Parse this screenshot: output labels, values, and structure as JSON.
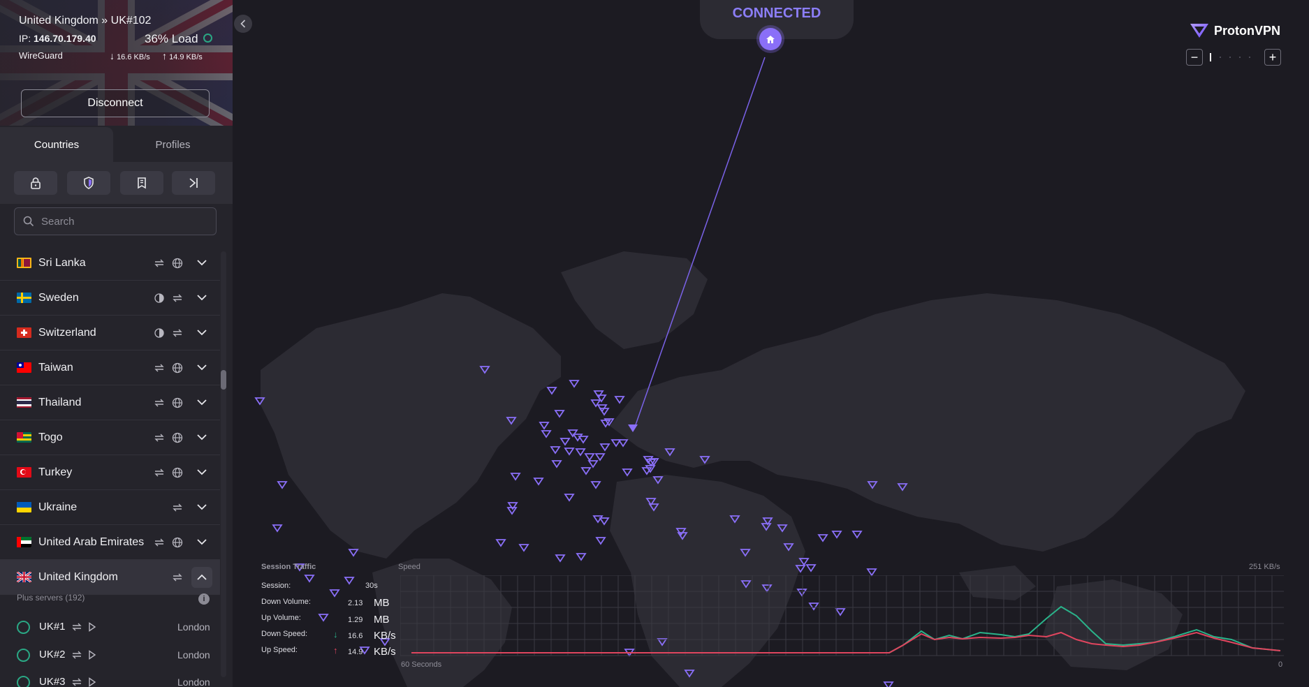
{
  "header": {
    "server_title": "United Kingdom » UK#102",
    "ip_label": "IP:",
    "ip_value": "146.70.179.40",
    "load": "36% Load",
    "protocol": "WireGuard",
    "down_rate": "16.6 KB/s",
    "up_rate": "14.9 KB/s",
    "disconnect_label": "Disconnect"
  },
  "tabs": {
    "countries": "Countries",
    "profiles": "Profiles"
  },
  "filters": {
    "icons": [
      "lock-icon",
      "shield-icon",
      "bill-icon",
      "skip-icon"
    ]
  },
  "search": {
    "placeholder": "Search"
  },
  "countries": [
    {
      "name": "Sri Lanka",
      "features": [
        "p2p-icon",
        "tor-globe-icon"
      ]
    },
    {
      "name": "Sweden",
      "features": [
        "secure-core-icon",
        "p2p-icon"
      ]
    },
    {
      "name": "Switzerland",
      "features": [
        "secure-core-icon",
        "p2p-icon"
      ]
    },
    {
      "name": "Taiwan",
      "features": [
        "p2p-icon",
        "tor-globe-icon"
      ]
    },
    {
      "name": "Thailand",
      "features": [
        "p2p-icon",
        "tor-globe-icon"
      ]
    },
    {
      "name": "Togo",
      "features": [
        "p2p-icon",
        "tor-globe-icon"
      ]
    },
    {
      "name": "Turkey",
      "features": [
        "p2p-icon",
        "tor-globe-icon"
      ]
    },
    {
      "name": "Ukraine",
      "features": [
        "p2p-icon"
      ]
    },
    {
      "name": "United Arab Emirates",
      "features": [
        "p2p-icon",
        "tor-globe-icon"
      ]
    },
    {
      "name": "United Kingdom",
      "features": [
        "p2p-icon"
      ]
    }
  ],
  "plus_servers": "Plus servers (192)",
  "servers": [
    {
      "name": "UK#1",
      "city": "London"
    },
    {
      "name": "UK#2",
      "city": "London"
    },
    {
      "name": "UK#3",
      "city": "London"
    }
  ],
  "map": {
    "status": "CONNECTED",
    "brand": "ProtonVPN"
  },
  "traffic": {
    "title": "Session Traffic",
    "speed_label": "Speed",
    "max_label": "251 KB/s",
    "session_label": "Session:",
    "session_value": "30s",
    "down_volume_label": "Down Volume:",
    "down_volume_value": "2.13",
    "down_volume_unit": "MB",
    "up_volume_label": "Up Volume:",
    "up_volume_value": "1.29",
    "up_volume_unit": "MB",
    "down_speed_label": "Down Speed:",
    "down_speed_value": "16.6",
    "down_speed_unit": "KB/s",
    "up_speed_label": "Up Speed:",
    "up_speed_value": "14.9",
    "up_speed_unit": "KB/s",
    "x_start": "60 Seconds",
    "x_end": "0"
  },
  "colors": {
    "accent": "#8a6ff8",
    "down_line": "#2ab38a",
    "up_line": "#e0455e",
    "connected": "#8c7ef8"
  }
}
